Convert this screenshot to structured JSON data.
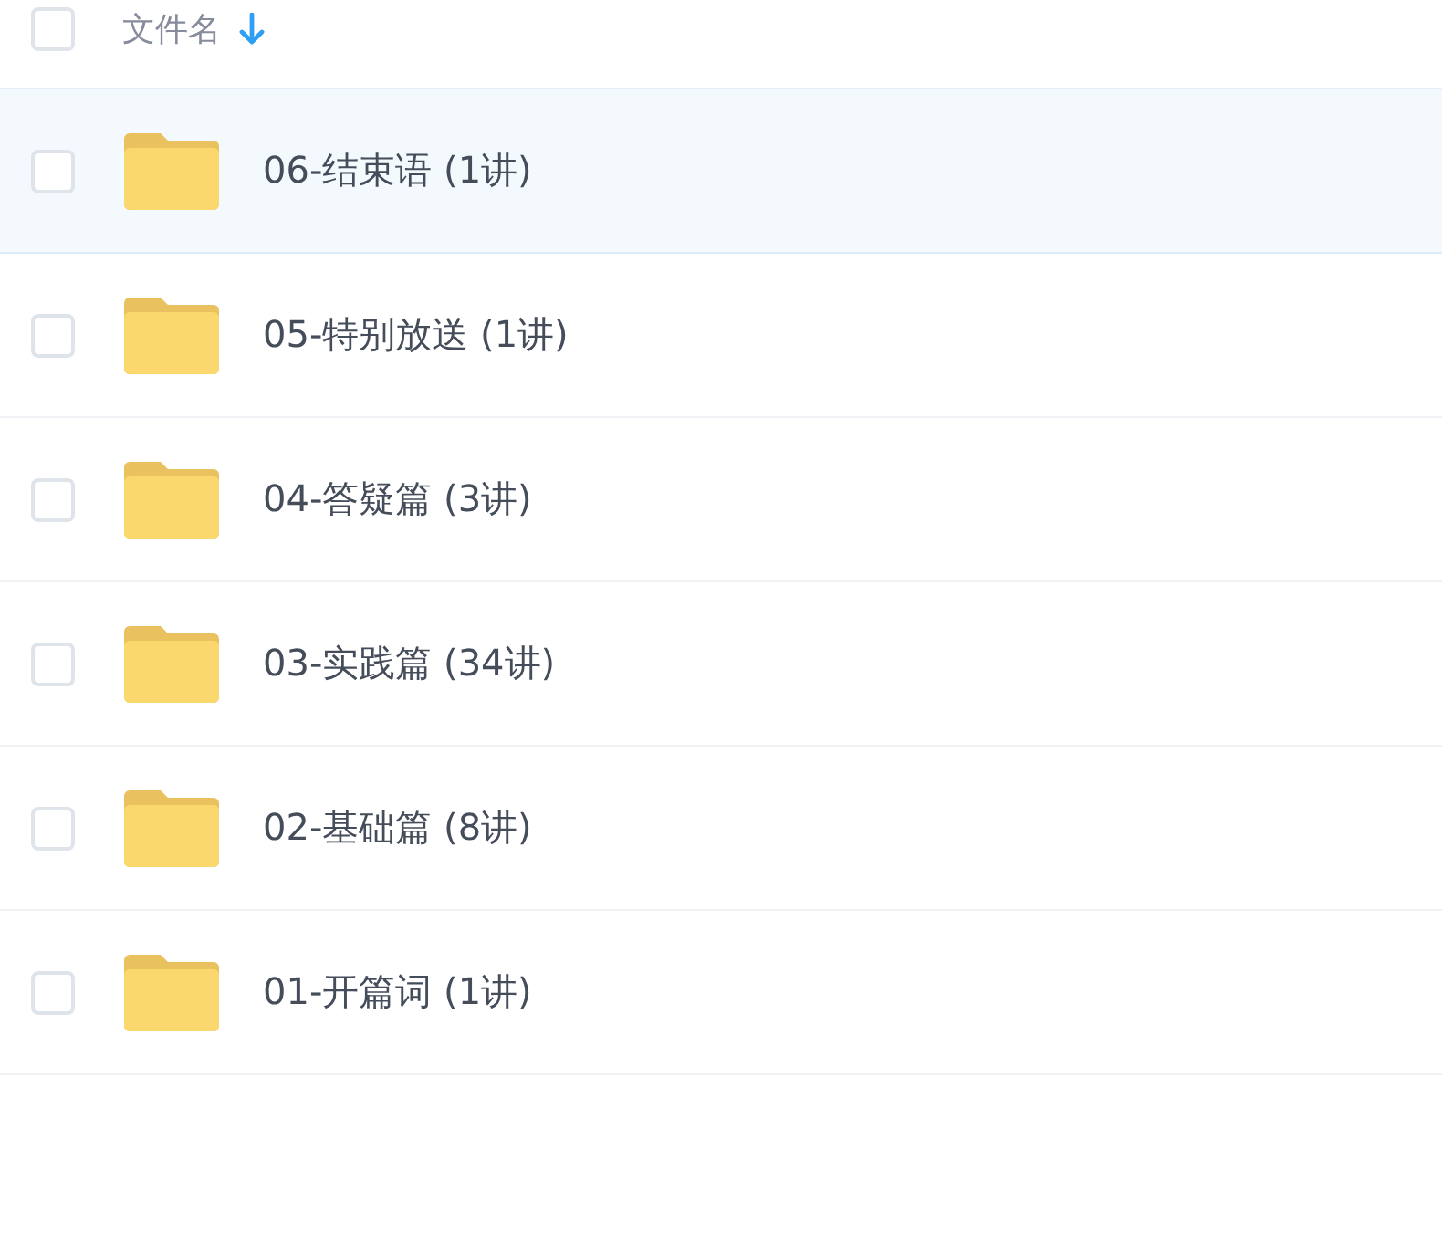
{
  "header": {
    "checked": false,
    "label": "文件名",
    "sort_descending": true
  },
  "rows": [
    {
      "name": "06-结束语 (1讲)",
      "selected": true,
      "checked": false
    },
    {
      "name": "05-特别放送 (1讲)",
      "selected": false,
      "checked": false
    },
    {
      "name": "04-答疑篇 (3讲)",
      "selected": false,
      "checked": false
    },
    {
      "name": "03-实践篇 (34讲)",
      "selected": false,
      "checked": false
    },
    {
      "name": "02-基础篇 (8讲)",
      "selected": false,
      "checked": false
    },
    {
      "name": "01-开篇词 (1讲)",
      "selected": false,
      "checked": false
    }
  ]
}
